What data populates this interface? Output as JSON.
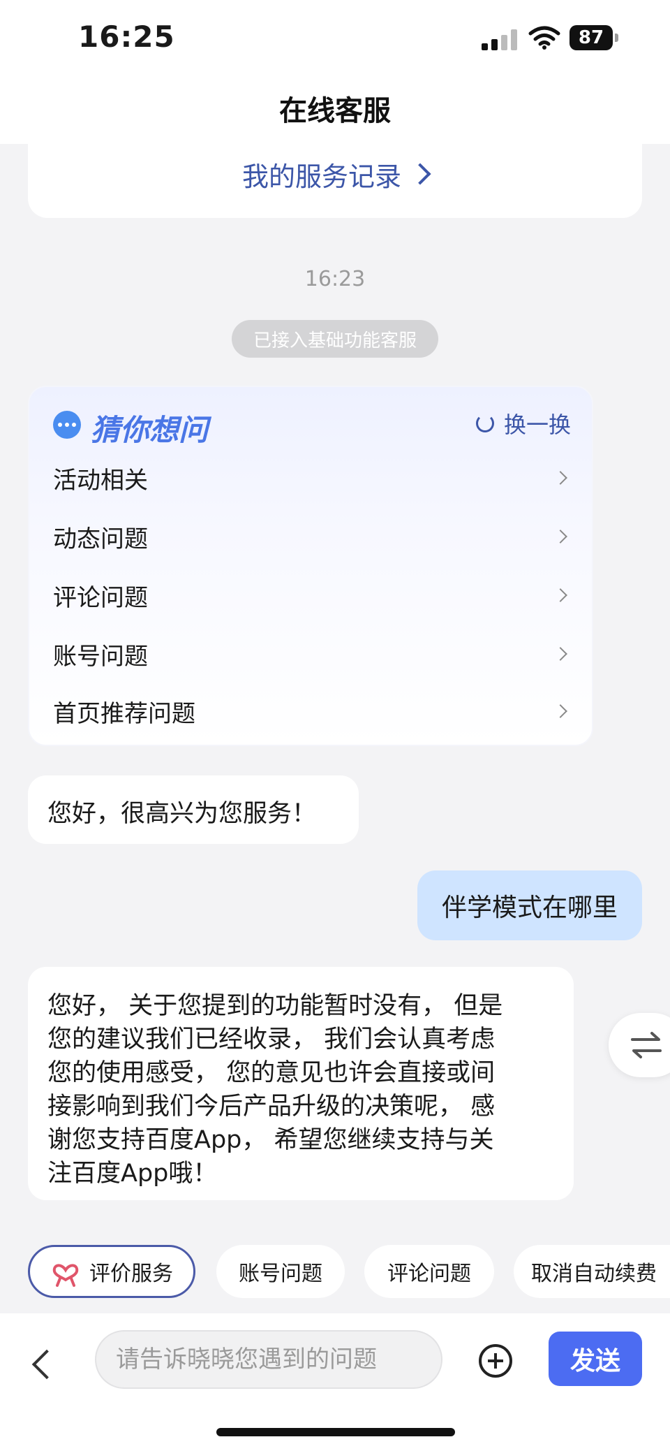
{
  "status_bar": {
    "time": "16:25",
    "battery": "87"
  },
  "header": {
    "title": "在线客服"
  },
  "record_link": {
    "label": "我的服务记录"
  },
  "chat": {
    "timestamp": "16:23",
    "system_notice": "已接入基础功能客服",
    "guess_card": {
      "title": "猜你想问",
      "refresh_label": "换一换",
      "items": [
        "活动相关",
        "动态问题",
        "评论问题",
        "账号问题",
        "首页推荐问题"
      ]
    },
    "greeting": "您好，很高兴为您服务！",
    "user_message": "伴学模式在哪里",
    "reply_lines": [
      "您好， 关于您提到的功能暂时没有， 但是",
      "您的建议我们已经收录， 我们会认真考虑",
      "您的使用感受， 您的意见也许会直接或间",
      "接影响到我们今后产品升级的决策呢， 感",
      "谢您支持百度App， 希望您继续支持与关",
      "注百度App哦！"
    ]
  },
  "quick_chips": [
    "评价服务",
    "账号问题",
    "评论问题",
    "取消自动续费"
  ],
  "composer": {
    "placeholder": "请告诉晓晓您遇到的问题",
    "send_label": "发送"
  },
  "colors": {
    "accent": "#4c6cf2",
    "link": "#3c56a8",
    "user_bubble": "#cfe4ff",
    "guess_title": "#4a76e6",
    "rate_icon": "#e0556a"
  },
  "icons": [
    "signal-icon",
    "wifi-icon",
    "battery-icon",
    "chevron-right-icon",
    "chat-bubble-icon",
    "refresh-icon",
    "swap-icon",
    "heart-hands-icon",
    "back-icon",
    "plus-circle-icon"
  ]
}
